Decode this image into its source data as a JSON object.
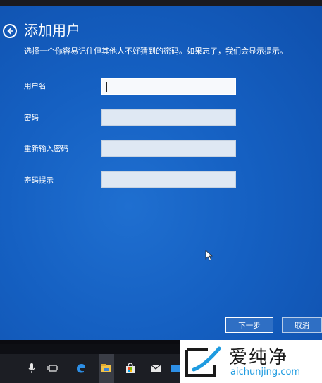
{
  "header": {
    "title": "添加用户",
    "subtitle": "选择一个你容易记住但其他人不好猜到的密码。如果忘了，我们会显示提示。"
  },
  "form": {
    "username_label": "用户名",
    "password_label": "密码",
    "reenter_label": "重新输入密码",
    "hint_label": "密码提示",
    "username_value": "",
    "password_value": "",
    "reenter_value": "",
    "hint_value": ""
  },
  "buttons": {
    "next": "下一步",
    "cancel": "取消"
  },
  "taskbar": {
    "icons": [
      "microphone-icon",
      "task-view-icon",
      "edge-icon",
      "file-explorer-icon",
      "store-icon",
      "mail-icon"
    ]
  },
  "watermark": {
    "name": "爱纯净",
    "url": "aichunjing.com"
  },
  "colors": {
    "background": "#1560c2",
    "text": "#ffffff",
    "field": "#dfe8f3",
    "taskbar": "#1c1e24",
    "watermark_url": "#1e9be0"
  }
}
